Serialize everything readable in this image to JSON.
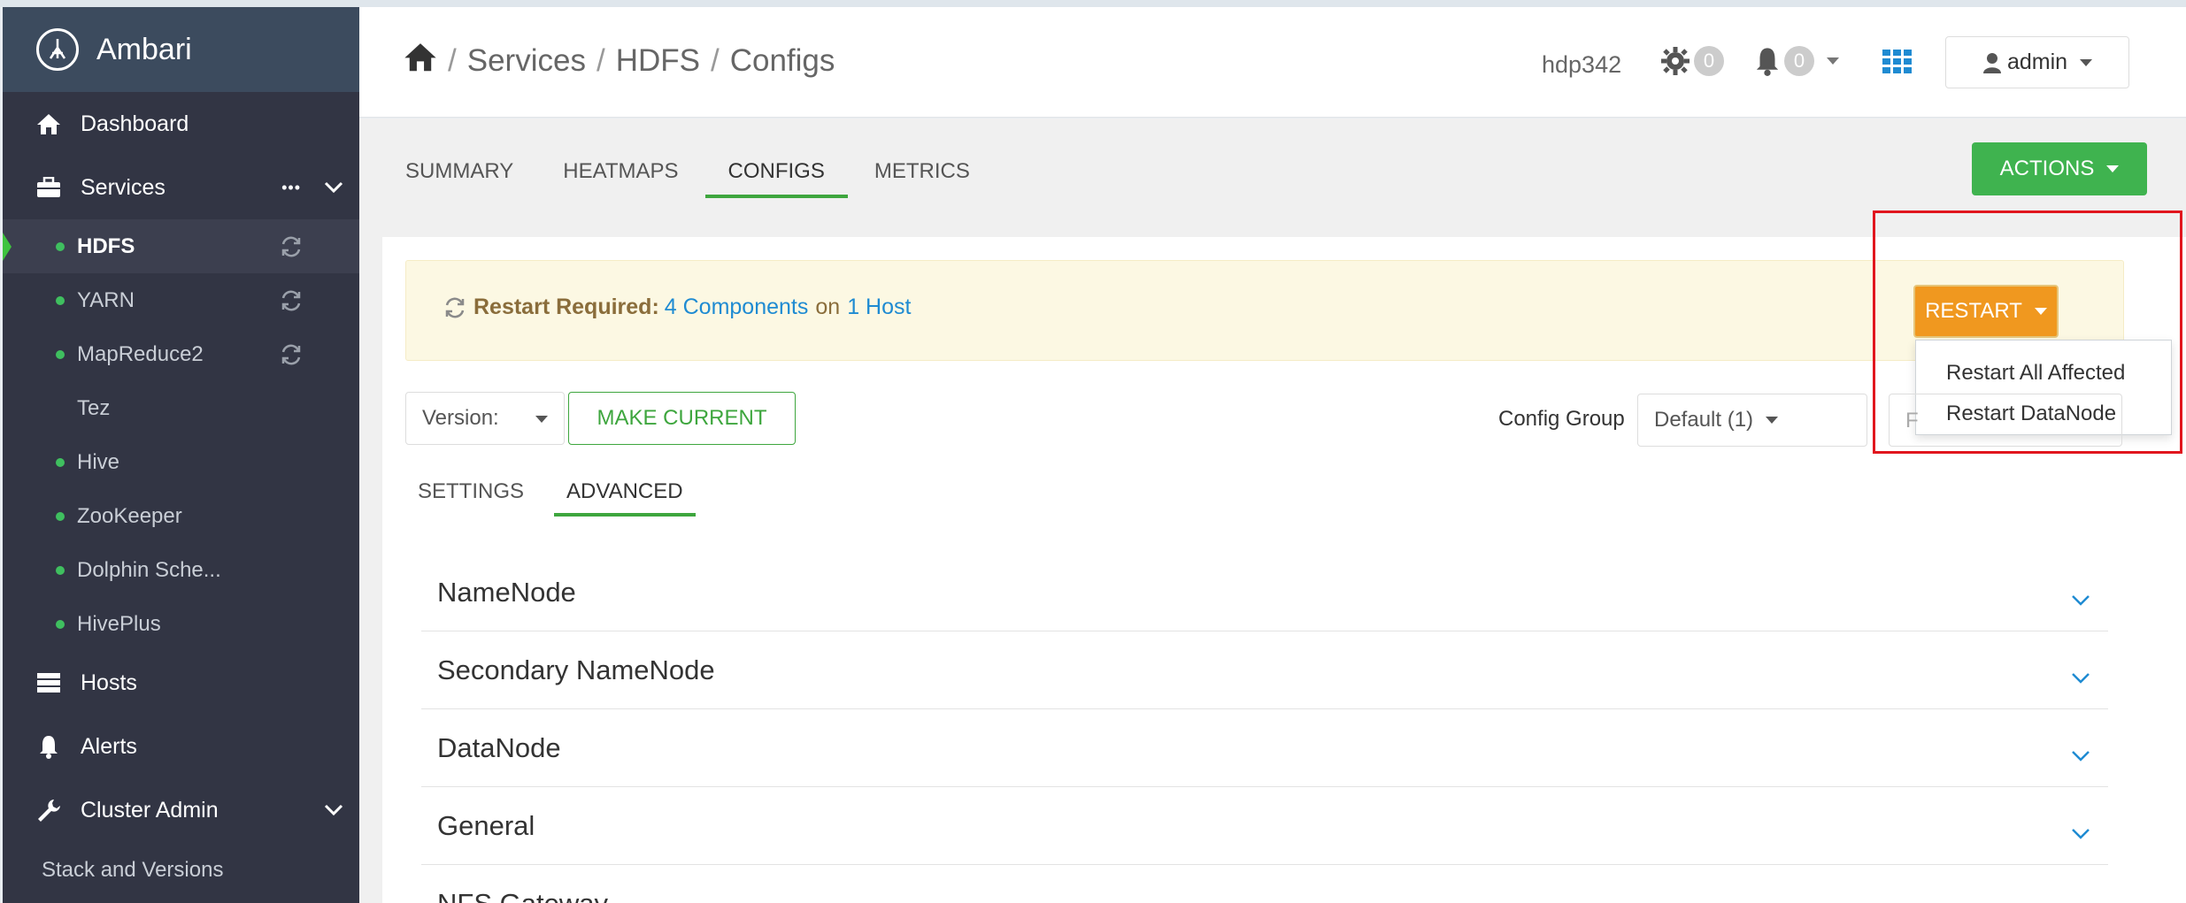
{
  "brand": {
    "name": "Ambari"
  },
  "sidebar": {
    "dashboard": "Dashboard",
    "services": "Services",
    "services_more": "•••",
    "service_items": [
      {
        "label": "HDFS",
        "status": "green",
        "restart": true,
        "active": true
      },
      {
        "label": "YARN",
        "status": "green",
        "restart": true
      },
      {
        "label": "MapReduce2",
        "status": "green",
        "restart": true
      },
      {
        "label": "Tez",
        "status": "none",
        "restart": false
      },
      {
        "label": "Hive",
        "status": "green",
        "restart": false
      },
      {
        "label": "ZooKeeper",
        "status": "green",
        "restart": false
      },
      {
        "label": "Dolphin Sche...",
        "status": "green",
        "restart": false
      },
      {
        "label": "HivePlus",
        "status": "green",
        "restart": false
      }
    ],
    "hosts": "Hosts",
    "alerts": "Alerts",
    "cluster_admin": "Cluster Admin",
    "stack_versions": "Stack and Versions"
  },
  "header": {
    "breadcrumb": [
      "Services",
      "HDFS",
      "Configs"
    ],
    "breadcrumb_sep": "/",
    "cluster": "hdp342",
    "ops_count": "0",
    "alerts_count": "0",
    "user": "admin"
  },
  "tabs": {
    "items": [
      "SUMMARY",
      "HEATMAPS",
      "CONFIGS",
      "METRICS"
    ],
    "active": "CONFIGS",
    "actions": "ACTIONS"
  },
  "alert": {
    "label": "Restart Required:",
    "components": "4 Components",
    "on": "on",
    "host": "1 Host",
    "restart_button": "RESTART"
  },
  "restart_menu": [
    "Restart All Affected",
    "Restart DataNode"
  ],
  "toolbar": {
    "version_label": "Version:",
    "make_current": "MAKE CURRENT",
    "config_group_label": "Config Group",
    "config_group_value": "Default (1)",
    "filter_placeholder": "F"
  },
  "subtabs": {
    "settings": "SETTINGS",
    "advanced": "ADVANCED"
  },
  "sections": [
    "NameNode",
    "Secondary NameNode",
    "DataNode",
    "General",
    "NFS Gateway"
  ],
  "colors": {
    "accent_green": "#3ea63e",
    "restart_orange": "#f0981f",
    "sidebar_bg": "#323544",
    "highlight": "#e1161e"
  }
}
